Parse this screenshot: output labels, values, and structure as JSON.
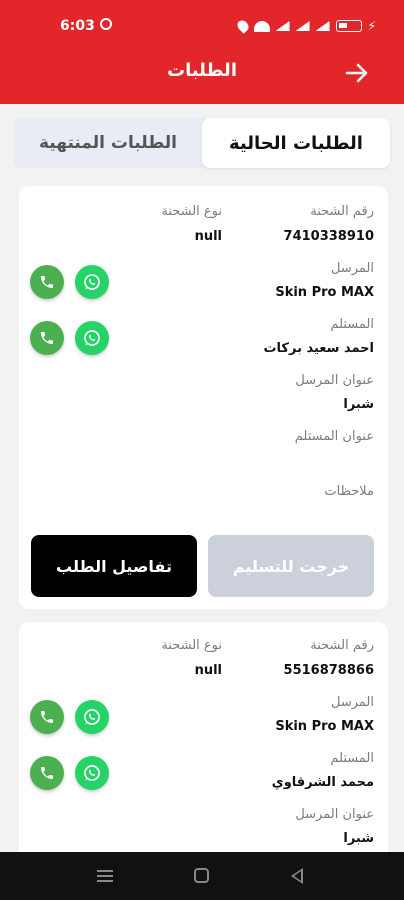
{
  "status_bar": {
    "time": "6:03"
  },
  "header": {
    "title": "الطلبات"
  },
  "tabs": {
    "current": "الطلبات الحالية",
    "finished": "الطلبات المنتهية"
  },
  "orders": [
    {
      "shipment_no_label": "رقم الشحنة",
      "shipment_no": "7410338910",
      "shipment_type_label": "نوع الشحنة",
      "shipment_type": "null",
      "sender_label": "المرسل",
      "sender": "Skin Pro MAX",
      "recipient_label": "المستلم",
      "recipient": "احمد سعيد بركات",
      "sender_address_label": "عنوان المرسل",
      "sender_address": "شبرا",
      "recipient_address_label": "عنوان المستلم",
      "notes_label": "ملاحظات",
      "details_button": "تفاصيل الطلب",
      "delivery_button": "خرجت للتسليم"
    },
    {
      "shipment_no_label": "رقم الشحنة",
      "shipment_no": "5516878866",
      "shipment_type_label": "نوع الشحنة",
      "shipment_type": "null",
      "sender_label": "المرسل",
      "sender": "Skin Pro MAX",
      "recipient_label": "المستلم",
      "recipient": "محمد الشرقاوي",
      "sender_address_label": "عنوان المرسل",
      "sender_address": "شبرا"
    }
  ],
  "colors": {
    "brand": "#e3262a",
    "phone": "#4caf50",
    "whatsapp": "#25d366",
    "disabled_button": "#cbd0db"
  },
  "icons": {
    "back": "arrow-right-icon",
    "phone": "phone-icon",
    "whatsapp": "whatsapp-icon"
  }
}
